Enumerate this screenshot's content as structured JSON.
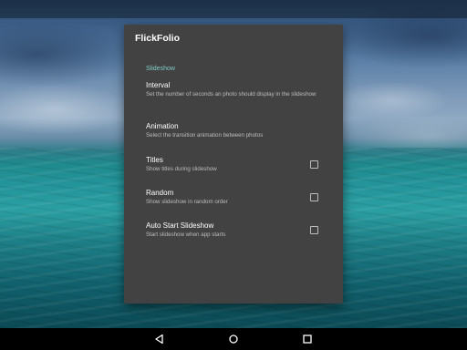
{
  "app": {
    "title": "FlickFolio"
  },
  "settings": {
    "section_header": "Slideshow",
    "items": [
      {
        "title": "Interval",
        "summary": "Set the number of seconds an photo should display in the slideshow",
        "has_checkbox": false
      },
      {
        "title": "Animation",
        "summary": "Select the transition animation between photos",
        "has_checkbox": false
      },
      {
        "title": "Titles",
        "summary": "Show titles during slideshow",
        "has_checkbox": true,
        "checked": false
      },
      {
        "title": "Random",
        "summary": "Show slideshow in random order",
        "has_checkbox": true,
        "checked": false
      },
      {
        "title": "Auto Start Slideshow",
        "summary": "Start slideshow when app starts",
        "has_checkbox": true,
        "checked": false
      }
    ]
  },
  "nav_bar": {
    "buttons": [
      {
        "icon": "back-icon"
      },
      {
        "icon": "home-icon"
      },
      {
        "icon": "recents-icon"
      }
    ]
  },
  "colors": {
    "dialog_background": "#424242",
    "section_accent": "#80cbc4",
    "title_text": "#ffffff",
    "summary_text": "#bdbdbd"
  }
}
